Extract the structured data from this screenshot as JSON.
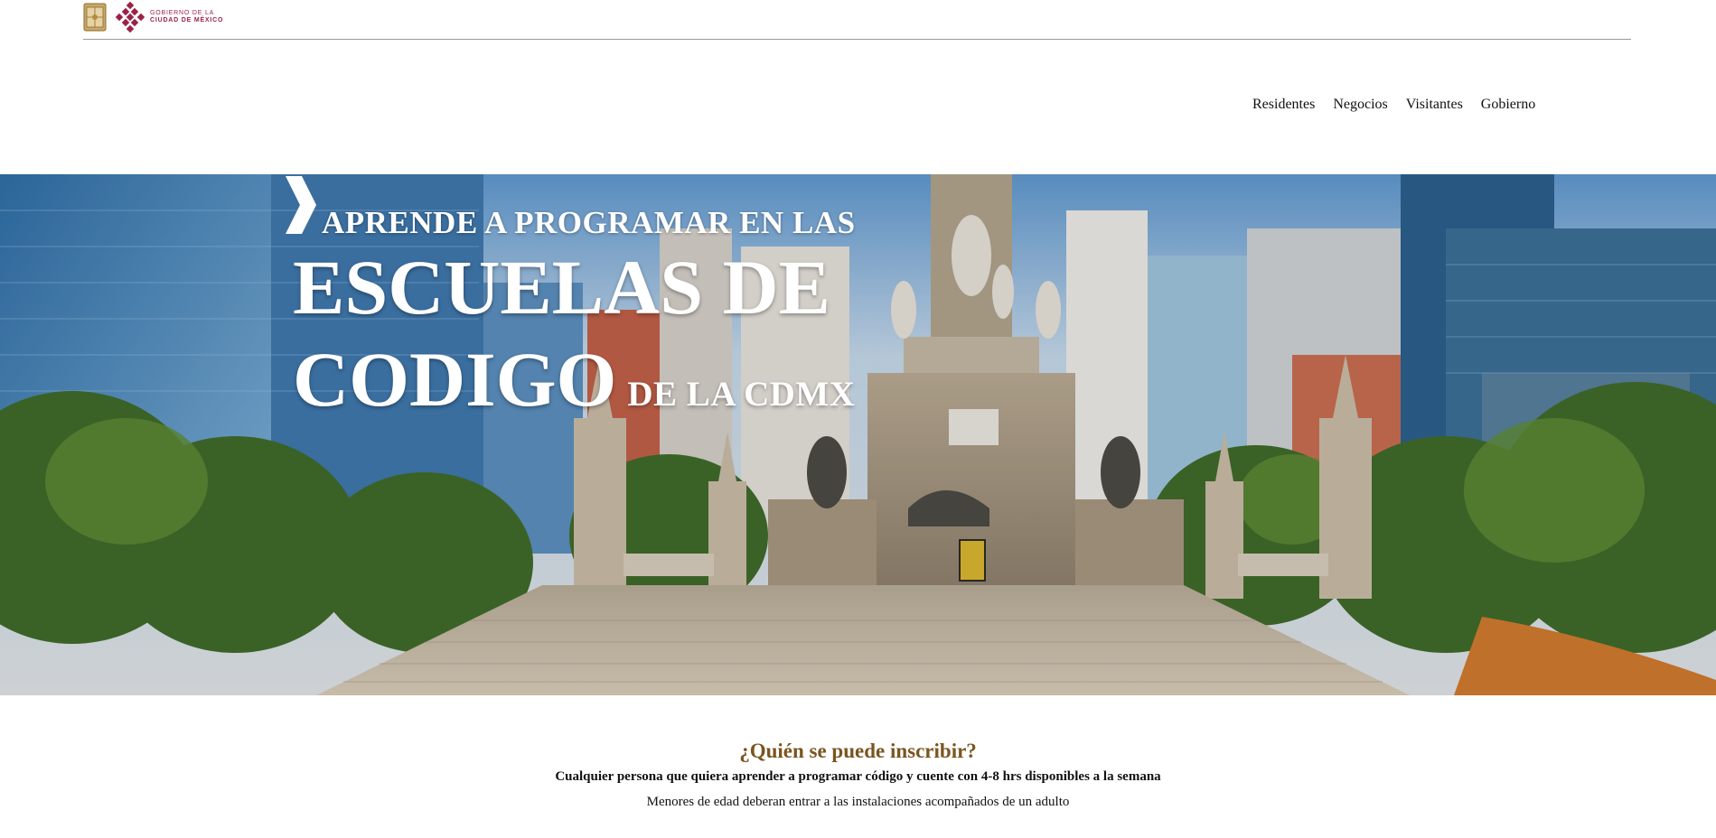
{
  "header": {
    "logo_line1": "GOBIERNO DE LA",
    "logo_line2": "CIUDAD DE MÉXICO",
    "brand_color": "#9b2247"
  },
  "nav": {
    "items": [
      {
        "label": "Residentes"
      },
      {
        "label": "Negocios"
      },
      {
        "label": "Visitantes"
      },
      {
        "label": "Gobierno"
      }
    ]
  },
  "hero": {
    "line1": "APRENDE A PROGRAMAR EN LAS",
    "line2": "ESCUELAS DE",
    "line3": "CODIGO",
    "line3_small": "DE LA CDMX",
    "icon": "chevron-right-icon"
  },
  "info": {
    "heading": "¿Quién se puede inscribir?",
    "requirement": "Cualquier persona que quiera aprender a programar código y cuente con 4-8 hrs disponibles a la semana",
    "note": "Menores de edad deberan entrar a las instalaciones acompañados de un adulto",
    "heading_color": "#7a5520"
  }
}
